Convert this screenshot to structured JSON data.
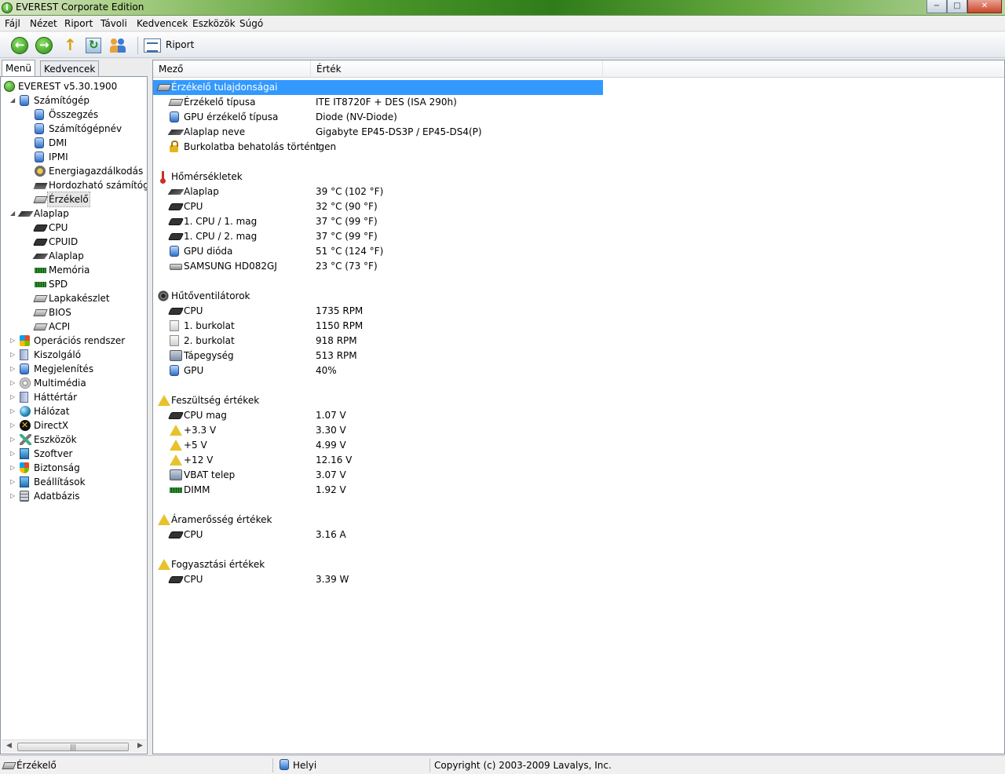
{
  "window": {
    "title": "EVEREST Corporate Edition",
    "minimize": "−",
    "maximize": "□",
    "close": "✕"
  },
  "menu": [
    "Fájl",
    "Nézet",
    "Riport",
    "Távoli",
    "Kedvencek",
    "Eszközök",
    "Súgó"
  ],
  "toolbar": {
    "riport_label": "Riport"
  },
  "left_tabs": {
    "menu": "Menü",
    "favorites": "Kedvencek"
  },
  "tree": [
    {
      "label": "EVEREST v5.30.1900",
      "icon": "info-icon",
      "level": 0,
      "expander": ""
    },
    {
      "label": "Számítógép",
      "icon": "computer-icon",
      "level": 1,
      "expander": "◢"
    },
    {
      "label": "Összegzés",
      "icon": "computer-icon",
      "level": 2,
      "expander": ""
    },
    {
      "label": "Számítógépnév",
      "icon": "computer-icon",
      "level": 2,
      "expander": ""
    },
    {
      "label": "DMI",
      "icon": "computer-icon",
      "level": 2,
      "expander": ""
    },
    {
      "label": "IPMI",
      "icon": "computer-icon",
      "level": 2,
      "expander": ""
    },
    {
      "label": "Energiagazdálkodás",
      "icon": "energy-icon",
      "level": 2,
      "expander": ""
    },
    {
      "label": "Hordozható számítógé",
      "icon": "laptop-icon",
      "level": 2,
      "expander": ""
    },
    {
      "label": "Érzékelő",
      "icon": "sensor-icon",
      "level": 2,
      "expander": "",
      "selected": true
    },
    {
      "label": "Alaplap",
      "icon": "motherboard-icon",
      "level": 1,
      "expander": "◢"
    },
    {
      "label": "CPU",
      "icon": "cpu-icon",
      "level": 2,
      "expander": ""
    },
    {
      "label": "CPUID",
      "icon": "cpu-icon",
      "level": 2,
      "expander": ""
    },
    {
      "label": "Alaplap",
      "icon": "motherboard-icon",
      "level": 2,
      "expander": ""
    },
    {
      "label": "Memória",
      "icon": "memory-icon",
      "level": 2,
      "expander": ""
    },
    {
      "label": "SPD",
      "icon": "memory-icon",
      "level": 2,
      "expander": ""
    },
    {
      "label": "Lapkakészlet",
      "icon": "chipset-icon",
      "level": 2,
      "expander": ""
    },
    {
      "label": "BIOS",
      "icon": "chipset-icon",
      "level": 2,
      "expander": ""
    },
    {
      "label": "ACPI",
      "icon": "chipset-icon",
      "level": 2,
      "expander": ""
    },
    {
      "label": "Operációs rendszer",
      "icon": "windows-icon",
      "level": 1,
      "expander": "▷"
    },
    {
      "label": "Kiszolgáló",
      "icon": "server-icon",
      "level": 1,
      "expander": "▷"
    },
    {
      "label": "Megjelenítés",
      "icon": "monitor-icon",
      "level": 1,
      "expander": "▷"
    },
    {
      "label": "Multimédia",
      "icon": "multimedia-icon",
      "level": 1,
      "expander": "▷"
    },
    {
      "label": "Háttértár",
      "icon": "storage-icon",
      "level": 1,
      "expander": "▷"
    },
    {
      "label": "Hálózat",
      "icon": "network-icon",
      "level": 1,
      "expander": "▷"
    },
    {
      "label": "DirectX",
      "icon": "directx-icon",
      "level": 1,
      "expander": "▷"
    },
    {
      "label": "Eszközök",
      "icon": "devices-icon",
      "level": 1,
      "expander": "▷"
    },
    {
      "label": "Szoftver",
      "icon": "software-icon",
      "level": 1,
      "expander": "▷"
    },
    {
      "label": "Biztonság",
      "icon": "security-icon",
      "level": 1,
      "expander": "▷"
    },
    {
      "label": "Beállítások",
      "icon": "settings-icon",
      "level": 1,
      "expander": "▷"
    },
    {
      "label": "Adatbázis",
      "icon": "database-icon",
      "level": 1,
      "expander": "▷"
    }
  ],
  "scroll": {
    "left": "◀",
    "right": "▶",
    "grip": "|||"
  },
  "columns": {
    "field": "Mező",
    "value": "Érték"
  },
  "rows": [
    {
      "kind": "group",
      "field": "Érzékelő tulajdonságai",
      "icon": "sensor-icon",
      "highlight": true
    },
    {
      "kind": "item",
      "field": "Érzékelő típusa",
      "value": "ITE IT8720F + DES  (ISA 290h)",
      "icon": "sensor-icon"
    },
    {
      "kind": "item",
      "field": "GPU érzékelő típusa",
      "value": "Diode  (NV-Diode)",
      "icon": "monitor-icon"
    },
    {
      "kind": "item",
      "field": "Alaplap neve",
      "value": "Gigabyte EP45-DS3P / EP45-DS4(P)",
      "icon": "motherboard-icon"
    },
    {
      "kind": "item",
      "field": "Burkolatba behatolás történt",
      "value": "Igen",
      "icon": "lock-icon"
    },
    {
      "kind": "spacer"
    },
    {
      "kind": "group",
      "field": "Hőmérsékletek",
      "icon": "thermometer-icon"
    },
    {
      "kind": "item",
      "field": "Alaplap",
      "value": "39 °C  (102 °F)",
      "icon": "motherboard-icon"
    },
    {
      "kind": "item",
      "field": "CPU",
      "value": "32 °C  (90 °F)",
      "icon": "cpu-icon"
    },
    {
      "kind": "item",
      "field": "1. CPU / 1. mag",
      "value": "37 °C  (99 °F)",
      "icon": "cpu-icon"
    },
    {
      "kind": "item",
      "field": "1. CPU / 2. mag",
      "value": "37 °C  (99 °F)",
      "icon": "cpu-icon"
    },
    {
      "kind": "item",
      "field": "GPU dióda",
      "value": "51 °C  (124 °F)",
      "icon": "monitor-icon"
    },
    {
      "kind": "item",
      "field": "SAMSUNG HD082GJ",
      "value": "23 °C  (73 °F)",
      "icon": "hdd-icon"
    },
    {
      "kind": "spacer"
    },
    {
      "kind": "group",
      "field": "Hűtőventilátorok",
      "icon": "fan-icon"
    },
    {
      "kind": "item",
      "field": "CPU",
      "value": "1735 RPM",
      "icon": "cpu-icon"
    },
    {
      "kind": "item",
      "field": "1. burkolat",
      "value": "1150 RPM",
      "icon": "case-icon"
    },
    {
      "kind": "item",
      "field": "2. burkolat",
      "value": "918 RPM",
      "icon": "case-icon"
    },
    {
      "kind": "item",
      "field": "Tápegység",
      "value": "513 RPM",
      "icon": "psu-icon"
    },
    {
      "kind": "item",
      "field": "GPU",
      "value": "40%",
      "icon": "monitor-icon"
    },
    {
      "kind": "spacer"
    },
    {
      "kind": "group",
      "field": "Feszültség értékek",
      "icon": "warning-icon"
    },
    {
      "kind": "item",
      "field": "CPU mag",
      "value": "1.07 V",
      "icon": "cpu-icon"
    },
    {
      "kind": "item",
      "field": "+3.3 V",
      "value": "3.30 V",
      "icon": "warning-icon"
    },
    {
      "kind": "item",
      "field": "+5 V",
      "value": "4.99 V",
      "icon": "warning-icon"
    },
    {
      "kind": "item",
      "field": "+12 V",
      "value": "12.16 V",
      "icon": "warning-icon"
    },
    {
      "kind": "item",
      "field": "VBAT telep",
      "value": "3.07 V",
      "icon": "psu-icon"
    },
    {
      "kind": "item",
      "field": "DIMM",
      "value": "1.92 V",
      "icon": "memory-icon"
    },
    {
      "kind": "spacer"
    },
    {
      "kind": "group",
      "field": "Áramerősség értékek",
      "icon": "warning-icon"
    },
    {
      "kind": "item",
      "field": "CPU",
      "value": "3.16 A",
      "icon": "cpu-icon"
    },
    {
      "kind": "spacer"
    },
    {
      "kind": "group",
      "field": "Fogyasztási értékek",
      "icon": "warning-icon"
    },
    {
      "kind": "item",
      "field": "CPU",
      "value": "3.39 W",
      "icon": "cpu-icon"
    }
  ],
  "status": {
    "left": "Érzékelő",
    "middle": "Helyi",
    "right": "Copyright (c) 2003-2009 Lavalys, Inc."
  },
  "colors": {
    "highlight": "#3399ff",
    "titlebar_green": "#2f7c1a"
  }
}
